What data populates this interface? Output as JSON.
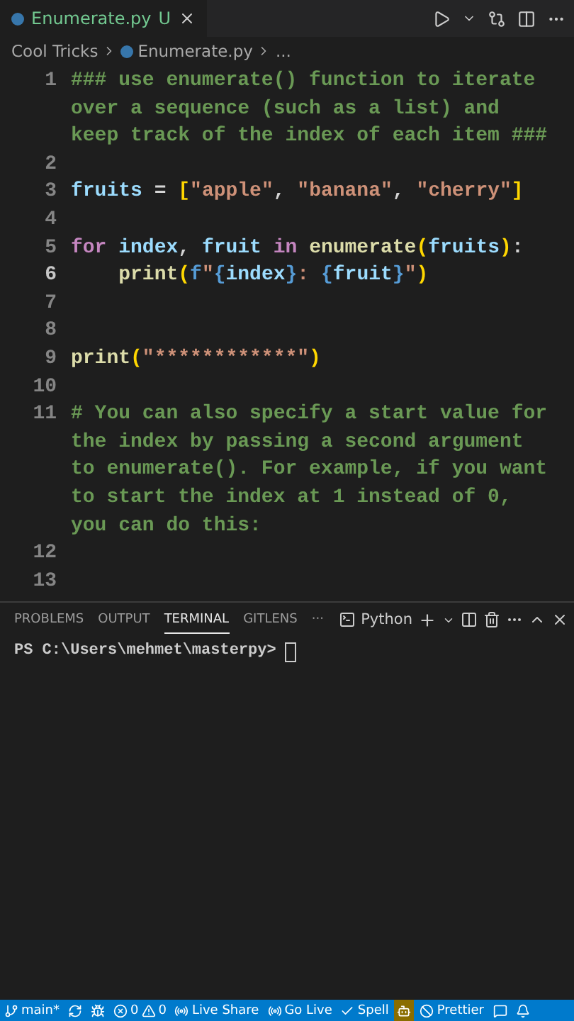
{
  "tab": {
    "title": "Enumerate.py",
    "badge": "U",
    "selected": true
  },
  "breadcrumb": [
    "Cool Tricks",
    "Enumerate.py",
    "..."
  ],
  "code_lines": [
    {
      "number": "1",
      "active": false,
      "tokens": [
        {
          "kind": "comment",
          "text": "### use enumerate() function to iterate over a sequence (such as a list) and keep track of the index of each item ###"
        }
      ]
    },
    {
      "number": "2",
      "active": false
    },
    {
      "number": "3",
      "active": false,
      "tokens": [
        {
          "kind": "variable",
          "text": "fruits"
        },
        {
          "kind": "plain",
          "text": " = "
        },
        {
          "kind": "bracket",
          "text": "["
        },
        {
          "kind": "string",
          "text": "\"apple\""
        },
        {
          "kind": "plain",
          "text": ", "
        },
        {
          "kind": "string",
          "text": "\"banana\""
        },
        {
          "kind": "plain",
          "text": ", "
        },
        {
          "kind": "string",
          "text": "\"cherry\""
        },
        {
          "kind": "bracket",
          "text": "]"
        }
      ]
    },
    {
      "number": "4",
      "active": false
    },
    {
      "number": "5",
      "active": false,
      "tokens": [
        {
          "kind": "keyword",
          "text": "for"
        },
        {
          "kind": "variable",
          "text": " index"
        },
        {
          "kind": "plain",
          "text": ", "
        },
        {
          "kind": "variable",
          "text": "fruit"
        },
        {
          "kind": "keyword",
          "text": " in "
        },
        {
          "kind": "function",
          "text": "enumerate"
        },
        {
          "kind": "bracket",
          "text": "("
        },
        {
          "kind": "variable",
          "text": "fruits"
        },
        {
          "kind": "bracket",
          "text": ")"
        },
        {
          "kind": "plain",
          "text": ":"
        }
      ]
    },
    {
      "number": "6",
      "active": true,
      "tokens": [
        {
          "kind": "function",
          "text": "    print"
        },
        {
          "kind": "bracket",
          "text": "("
        },
        {
          "kind": "storage",
          "text": "f"
        },
        {
          "kind": "string",
          "text": "\""
        },
        {
          "kind": "brace",
          "text": "{"
        },
        {
          "kind": "variable",
          "text": "index"
        },
        {
          "kind": "brace",
          "text": "}"
        },
        {
          "kind": "string",
          "text": ": "
        },
        {
          "kind": "brace",
          "text": "{"
        },
        {
          "kind": "variable",
          "text": "fruit"
        },
        {
          "kind": "brace",
          "text": "}"
        },
        {
          "kind": "string",
          "text": "\""
        },
        {
          "kind": "bracket",
          "text": ")"
        }
      ]
    },
    {
      "number": "7",
      "active": false
    },
    {
      "number": "8",
      "active": false
    },
    {
      "number": "9",
      "active": false,
      "tokens": [
        {
          "kind": "function",
          "text": "print"
        },
        {
          "kind": "bracket",
          "text": "("
        },
        {
          "kind": "string",
          "text": "\"************\""
        },
        {
          "kind": "bracket",
          "text": ")"
        }
      ]
    },
    {
      "number": "10",
      "active": false
    },
    {
      "number": "11",
      "active": false,
      "tokens": [
        {
          "kind": "comment",
          "text": "# You can also specify a start value for the index by passing a second argument to enumerate(). For example, if you want to start the index at 1 instead of 0, you can do this:"
        }
      ]
    },
    {
      "number": "12",
      "active": false
    },
    {
      "number": "13",
      "active": false
    }
  ],
  "panel": {
    "tabs": [
      {
        "label": "PROBLEMS",
        "selected": false
      },
      {
        "label": "OUTPUT",
        "selected": false
      },
      {
        "label": "TERMINAL",
        "selected": true
      },
      {
        "label": "GITLENS",
        "selected": false
      }
    ],
    "more": "···",
    "terminal_name": "Python",
    "prompt": "PS C:\\Users\\mehmet\\masterpy> "
  },
  "status_bar": [
    {
      "kind": "branch",
      "text": "main*"
    },
    {
      "kind": "sync"
    },
    {
      "kind": "bug"
    },
    {
      "kind": "problems",
      "errors": "0",
      "warnings": "0"
    },
    {
      "kind": "liveshare",
      "text": "Live Share"
    },
    {
      "kind": "golive",
      "text": "Go Live"
    },
    {
      "kind": "spell",
      "text": "Spell"
    },
    {
      "kind": "copilot"
    },
    {
      "kind": "prettier",
      "text": "Prettier"
    },
    {
      "kind": "feedback"
    },
    {
      "kind": "bell"
    }
  ]
}
